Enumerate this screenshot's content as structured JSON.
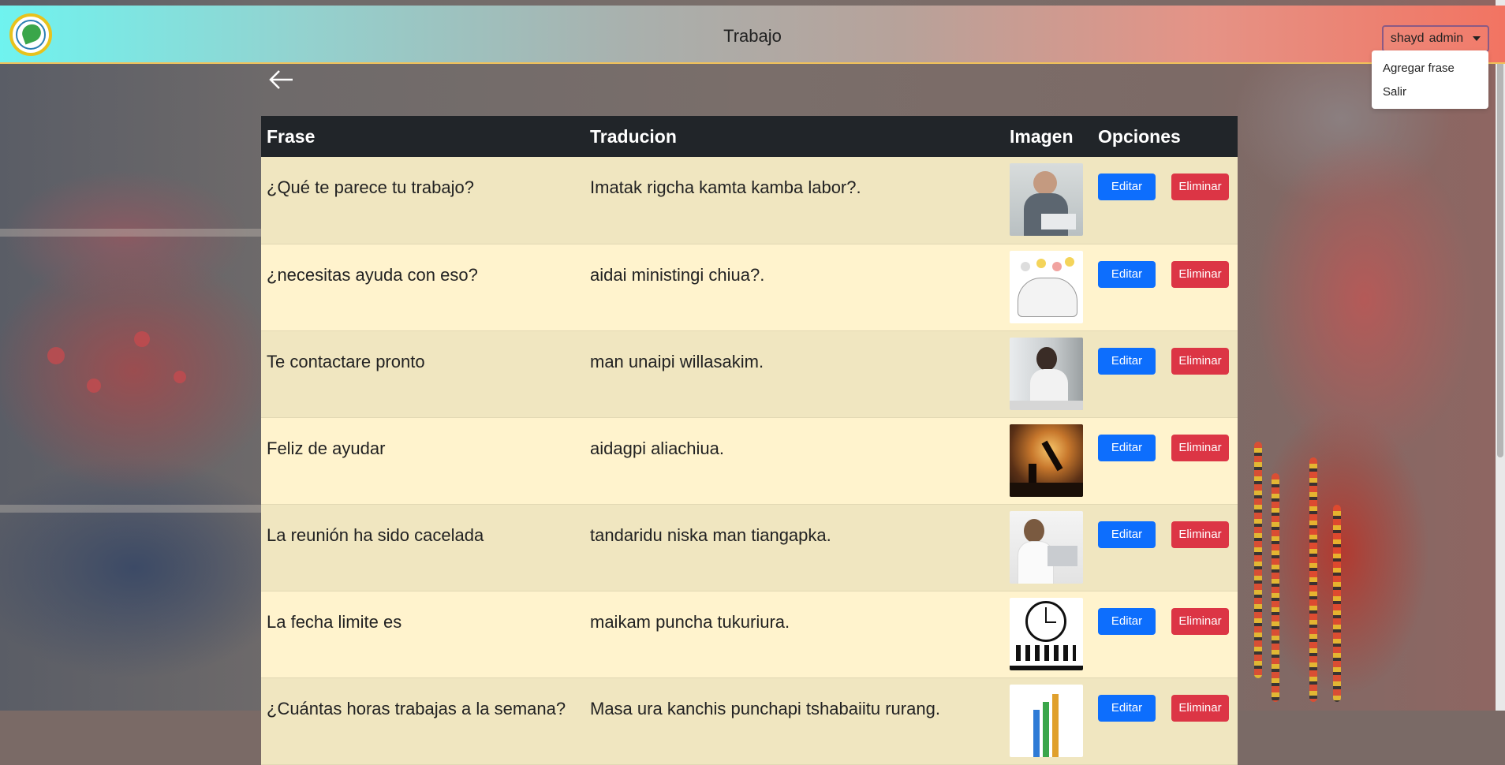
{
  "header": {
    "title": "Trabajo",
    "user_name": "shayd",
    "user_role": "admin"
  },
  "dropdown": {
    "items": [
      "Agregar frase",
      "Salir"
    ]
  },
  "table": {
    "headers": [
      "Frase",
      "Traducion",
      "Imagen",
      "Opciones"
    ],
    "edit_label": "Editar",
    "delete_label": "Eliminar",
    "rows": [
      {
        "frase": "¿Qué te parece tu trabajo?",
        "traduccion": "Imatak rigcha kamta kamba labor?.",
        "image": "man-with-laptop"
      },
      {
        "frase": "¿necesitas ayuda con eso?",
        "traduccion": "aidai ministingi chiua?.",
        "image": "team-sketch"
      },
      {
        "frase": "Te contactare pronto",
        "traduccion": "man unaipi willasakim.",
        "image": "woman-on-phone"
      },
      {
        "frase": "Feliz de ayudar",
        "traduccion": "aidagpi aliachiua.",
        "image": "helping-hand-sunset"
      },
      {
        "frase": "La reunión ha sido cacelada",
        "traduccion": "tandaridu niska man tiangapka.",
        "image": "woman-at-laptop"
      },
      {
        "frase": "La fecha limite es",
        "traduccion": "maikam puncha tukuriura.",
        "image": "clock-deadline"
      },
      {
        "frase": "¿Cuántas horas trabajas a la semana?",
        "traduccion": "Masa ura kanchis punchapi tshabaiitu rurang.",
        "image": "growth-chart"
      }
    ]
  }
}
